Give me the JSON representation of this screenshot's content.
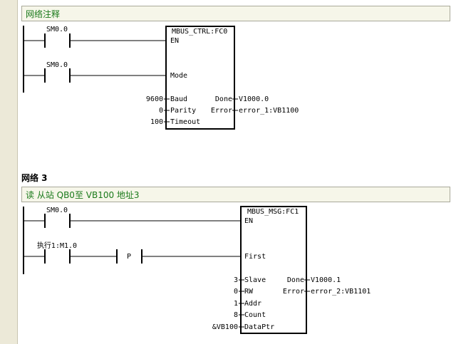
{
  "network2": {
    "comment": "网络注释",
    "contact1_label": "SM0.0",
    "contact2_label": "SM0.0",
    "block": {
      "title": "MBUS_CTRL:FC0",
      "en": "EN",
      "mode": "Mode",
      "inputs": [
        {
          "value": "9600",
          "name": "Baud"
        },
        {
          "value": "0",
          "name": "Parity"
        },
        {
          "value": "100",
          "name": "Timeout"
        }
      ],
      "outputs": [
        {
          "name": "Done",
          "value": "V1000.0"
        },
        {
          "name": "Error",
          "value": "error_1:VB1100"
        }
      ]
    }
  },
  "network3": {
    "title": "网络 3",
    "comment": "读 从站 QB0至 VB100 地址3",
    "contact1_label": "SM0.0",
    "contact2_label": "执行1:M1.0",
    "p_label": "P",
    "block": {
      "title": "MBUS_MSG:FC1",
      "en": "EN",
      "first": "First",
      "inputs": [
        {
          "value": "3",
          "name": "Slave"
        },
        {
          "value": "0",
          "name": "RW"
        },
        {
          "value": "1",
          "name": "Addr"
        },
        {
          "value": "8",
          "name": "Count"
        },
        {
          "value": "&VB100",
          "name": "DataPtr"
        }
      ],
      "outputs": [
        {
          "name": "Done",
          "value": "V1000.1"
        },
        {
          "name": "Error",
          "value": "error_2:VB1101"
        }
      ]
    }
  }
}
